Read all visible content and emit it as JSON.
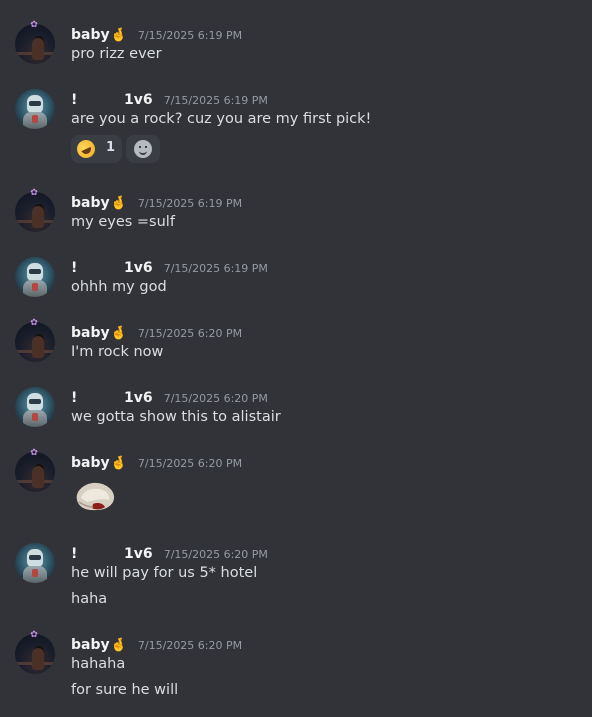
{
  "users": {
    "baby": {
      "name": "baby",
      "badge_icon": "crossed-fingers-icon"
    },
    "onev6": {
      "name_prefix": "!",
      "name": "1v6"
    }
  },
  "messages": [
    {
      "author": "baby",
      "timestamp": "7/15/2025 6:19 PM",
      "lines": [
        "pro rizz ever"
      ]
    },
    {
      "author": "onev6",
      "timestamp": "7/15/2025 6:19 PM",
      "lines": [
        "are you a rock? cuz you are my first pick!"
      ],
      "reactions": [
        {
          "emoji": "rofl-icon",
          "count": "1"
        }
      ]
    },
    {
      "author": "baby",
      "timestamp": "7/15/2025 6:19 PM",
      "lines": [
        "my eyes =sulf"
      ]
    },
    {
      "author": "onev6",
      "timestamp": "7/15/2025 6:19 PM",
      "lines": [
        "ohhh my god"
      ]
    },
    {
      "author": "baby",
      "timestamp": "7/15/2025 6:20 PM",
      "lines": [
        "I'm rock now"
      ]
    },
    {
      "author": "onev6",
      "timestamp": "7/15/2025 6:20 PM",
      "lines": [
        "we gotta show this to alistair"
      ]
    },
    {
      "author": "baby",
      "timestamp": "7/15/2025 6:20 PM",
      "attachment": "rock-image"
    },
    {
      "author": "onev6",
      "timestamp": "7/15/2025 6:20 PM",
      "lines": [
        "he will pay for us 5* hotel",
        "haha"
      ]
    },
    {
      "author": "baby",
      "timestamp": "7/15/2025 6:20 PM",
      "lines": [
        "hahaha",
        "for sure he will"
      ]
    }
  ],
  "colors": {
    "background": "#313338",
    "username": "#f2f3f5",
    "timestamp": "#949ba4",
    "text": "#dbdee1",
    "reaction_bg": "#3b3d44"
  }
}
